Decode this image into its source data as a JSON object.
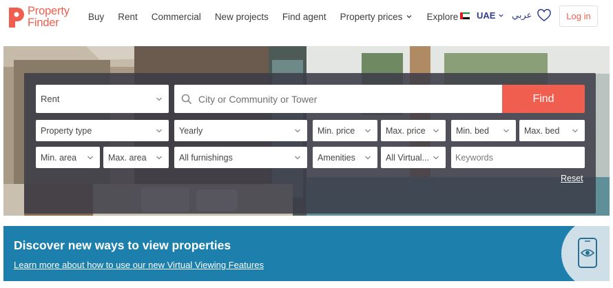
{
  "brand": {
    "name_line1": "Property",
    "name_line2": "Finder",
    "color": "#ef5e4e"
  },
  "nav": {
    "items": [
      {
        "label": "Buy",
        "dropdown": false
      },
      {
        "label": "Rent",
        "dropdown": false
      },
      {
        "label": "Commercial",
        "dropdown": false
      },
      {
        "label": "New projects",
        "dropdown": false
      },
      {
        "label": "Find agent",
        "dropdown": false
      },
      {
        "label": "Property prices",
        "dropdown": true
      },
      {
        "label": "Explore",
        "dropdown": true
      }
    ],
    "country": "UAE",
    "language": "عربي",
    "login": "Log in"
  },
  "search": {
    "category": "Rent",
    "location_placeholder": "City or Community or Tower",
    "find_label": "Find",
    "property_type": "Property type",
    "rent_period": "Yearly",
    "min_price": "Min. price",
    "max_price": "Max. price",
    "min_bed": "Min. bed",
    "max_bed": "Max. bed",
    "min_area": "Min. area",
    "max_area": "Max. area",
    "furnishings": "All furnishings",
    "amenities": "Amenities",
    "virtual_viewing": "All Virtual...",
    "keywords_placeholder": "Keywords",
    "reset_label": "Reset"
  },
  "banner": {
    "title": "Discover new ways to view properties",
    "link": "Learn more about how to use our new Virtual Viewing Features",
    "color": "#1d7fab"
  },
  "icons": [
    "logo-pin-icon",
    "chevron-down-icon",
    "uae-flag-icon",
    "heart-icon",
    "search-icon",
    "phone-eye-icon"
  ]
}
